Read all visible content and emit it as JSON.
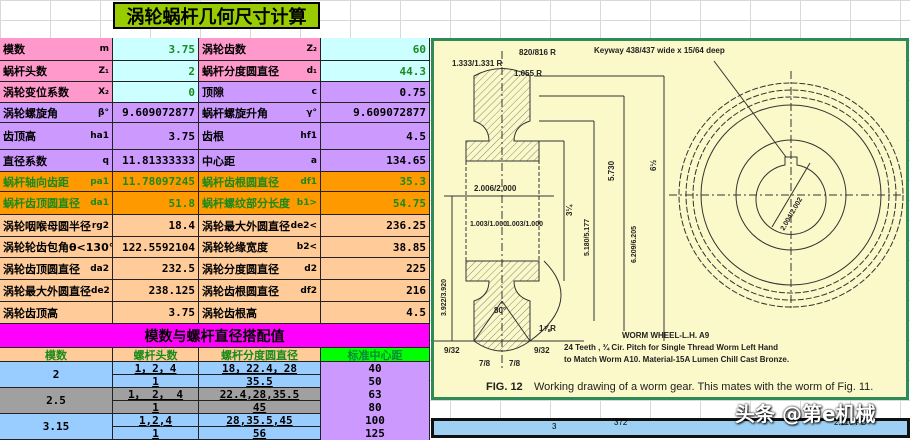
{
  "title": "涡轮蜗杆几何尺寸计算",
  "params": [
    {
      "label": "模数",
      "sym": "m",
      "value": "3.75",
      "label2": "涡轮齿数",
      "sym2": "Z₂",
      "value2": "60"
    },
    {
      "label": "蜗杆头数",
      "sym": "Z₁",
      "value": "2",
      "label2": "蜗杆分度圆直径",
      "sym2": "d₁",
      "value2": "44.3"
    },
    {
      "label": "涡轮变位系数",
      "sym": "X₂",
      "value": "0",
      "label2": "顶隙",
      "sym2": "c",
      "value2": "0.75"
    },
    {
      "label": "涡轮螺旋角",
      "sym": "β°",
      "value": "9.609072877",
      "label2": "蜗杆螺旋升角",
      "sym2": "γ°",
      "value2": "9.609072877"
    },
    {
      "label": "齿顶高",
      "sym": "ha1",
      "value": "3.75",
      "label2": "齿根",
      "sym2": "hf1",
      "value2": "4.5"
    },
    {
      "label": "直径系数",
      "sym": "q",
      "value": "11.81333333",
      "label2": "中心距",
      "sym2": "a",
      "value2": "134.65"
    },
    {
      "label": "蜗杆轴向齿距",
      "sym": "pa1",
      "value": "11.78097245",
      "label2": "蜗杆齿根圆直径",
      "sym2": "df1",
      "value2": "35.3"
    },
    {
      "label": "蜗杆齿顶圆直径",
      "sym": "da1",
      "value": "51.8",
      "label2": "蜗杆螺纹部分长度",
      "sym2": "b1>",
      "value2": "54.75"
    },
    {
      "label": "涡轮咽喉母圆半径",
      "sym": "rg2",
      "value": "18.4",
      "label2": "涡轮最大外圆直径",
      "sym2": "de2<",
      "value2": "236.25"
    },
    {
      "label": "涡轮轮齿包角θ<130°",
      "sym": "",
      "value": "122.5592104",
      "label2": "涡轮轮缘宽度",
      "sym2": "b2<",
      "value2": "38.85"
    },
    {
      "label": "涡轮齿顶圆直径",
      "sym": "da2",
      "value": "232.5",
      "label2": "涡轮分度圆直径",
      "sym2": "d2",
      "value2": "225"
    },
    {
      "label": "涡轮最大外圆直径",
      "sym": "de2",
      "value": "238.125",
      "label2": "涡轮齿根圆直径",
      "sym2": "df2",
      "value2": "216"
    },
    {
      "label": "涡轮齿顶高",
      "sym": "",
      "value": "3.75",
      "label2": "涡轮齿根高",
      "sym2": "",
      "value2": "4.5"
    }
  ],
  "match": {
    "title": "模数与螺杆直径搭配值",
    "headers": [
      "模数",
      "螺杆头数",
      "螺杆分度圆直径",
      "标准中心距"
    ],
    "groups": [
      {
        "module": "2",
        "rows": [
          [
            "1，2，4",
            "18，22.4，28"
          ],
          [
            "1",
            "35.5"
          ]
        ]
      },
      {
        "module": "2.5",
        "rows": [
          [
            "1， 2， 4",
            "22.4,28,35.5"
          ],
          [
            "1",
            "45"
          ]
        ]
      },
      {
        "module": "3.15",
        "rows": [
          [
            "1,2,4",
            "28,35.5,45"
          ],
          [
            "1",
            "56"
          ]
        ]
      }
    ],
    "center_distances": [
      "40",
      "50",
      "63",
      "80",
      "100",
      "125"
    ]
  },
  "drawing": {
    "labels": {
      "r1": "820/816 R",
      "r2": "1.333/1.331 R",
      "r3": "1.055 R",
      "keyway": "Keyway 438/437 wide x 15/64 deep",
      "d1": "5.730",
      "d2": "6½",
      "d3": "2.006/2.000",
      "d4": "3¼",
      "d5": "1.003/1.000",
      "d6": "1.003/1.000",
      "d7": "5.180/5.177",
      "d8": "6.209/6.205",
      "d9": "3.922/3.920",
      "d10": "2.004/2.002",
      "ang": "80°",
      "r4": "1⅞R",
      "f1": "9/32",
      "f2": "7/8",
      "f3": "7/8",
      "f4": "9/32"
    },
    "title": "WORM  WHEEL-L.H.  A9",
    "note1": "24 Teeth , ¾ Cir. Pitch for Single Thread Worm Left Hand",
    "note2": "to Match Worm A10.  Material-15A Lumen Chill Cast Bronze.",
    "caption_bold": "FIG. 12",
    "caption": "Working drawing of a worm gear. This mates with the worm of Fig. 11."
  },
  "bottom": {
    "a": "3",
    "b": "372",
    "c": "2.110 PD"
  },
  "watermark": "头条 @第e机械"
}
